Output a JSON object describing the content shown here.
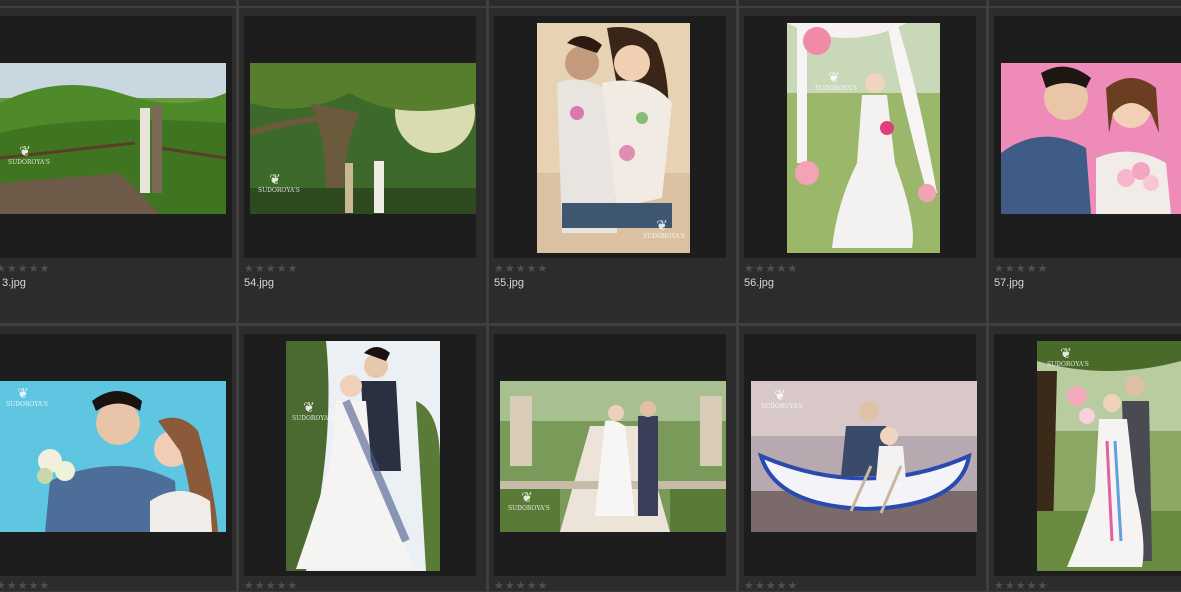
{
  "browser": {
    "rows": [
      {
        "items": [
          {
            "filename": "3.jpg",
            "rating": "★★★★★",
            "image": "suspension-bridge-couple"
          },
          {
            "filename": "54.jpg",
            "rating": "★★★★★",
            "image": "big-tree-sunlight-couple"
          },
          {
            "filename": "55.jpg",
            "rating": "★★★★★",
            "image": "holi-color-couple"
          },
          {
            "filename": "56.jpg",
            "rating": "★★★★★",
            "image": "bride-pink-flowers"
          },
          {
            "filename": "57.jpg",
            "rating": "★★★★★",
            "image": "couple-pink-background"
          }
        ]
      },
      {
        "items": [
          {
            "filename": "",
            "rating": "★★★★★",
            "image": "couple-blue-background"
          },
          {
            "filename": "",
            "rating": "★★★★★",
            "image": "couple-garden-wedding-dress"
          },
          {
            "filename": "",
            "rating": "★★★★★",
            "image": "garden-walkway-couple"
          },
          {
            "filename": "",
            "rating": "★★★★★",
            "image": "boat-on-beach-couple"
          },
          {
            "filename": "",
            "rating": "★★★★★",
            "image": "couple-under-tree"
          }
        ]
      }
    ],
    "watermark": "SUDOROYA'S"
  }
}
